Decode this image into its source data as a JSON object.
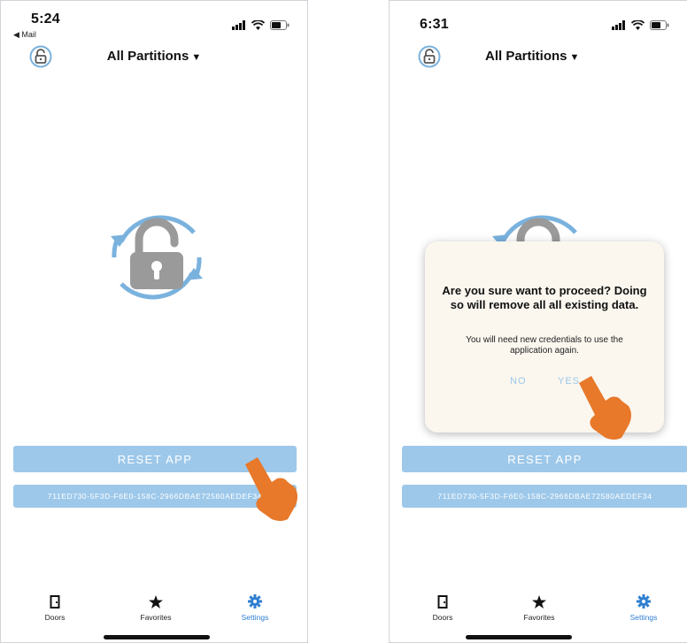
{
  "screens": [
    {
      "status": {
        "time": "5:24",
        "back_app": "◀ Mail"
      },
      "header": {
        "partition_label": "All Partitions",
        "caret": "▼"
      },
      "buttons": {
        "reset_label": "RESET APP",
        "uid_label": "711ED730-5F3D-F6E0-158C-2966DBAE72580AEDEF34"
      },
      "tabs": [
        {
          "label": "Doors",
          "icon": "door-icon"
        },
        {
          "label": "Favorites",
          "icon": "star-icon"
        },
        {
          "label": "Settings",
          "icon": "gear-icon"
        }
      ]
    },
    {
      "status": {
        "time": "6:31"
      },
      "header": {
        "partition_label": "All Partitions",
        "caret": "▼"
      },
      "dialog": {
        "title": "Are you sure want to proceed? Doing so will remove all all existing data.",
        "message": "You will need new credentials to use the application again.",
        "no_label": "NO",
        "yes_label": "YES"
      },
      "buttons": {
        "reset_label": "RESET APP",
        "uid_label": "711ED730-5F3D-F6E0-158C-2966DBAE72580AEDEF34"
      },
      "tabs": [
        {
          "label": "Doors",
          "icon": "door-icon"
        },
        {
          "label": "Favorites",
          "icon": "star-icon"
        },
        {
          "label": "Settings",
          "icon": "gear-icon"
        }
      ]
    }
  ],
  "colors": {
    "accent": "#2f7fd1",
    "button_bg": "#9dc8ea",
    "logo_ring": "#7ab2de",
    "logo_lock": "#9a9a9a",
    "dialog_bg": "#fbf7ef",
    "pointer_hand": "#e8782a"
  },
  "active_tab": "Settings"
}
